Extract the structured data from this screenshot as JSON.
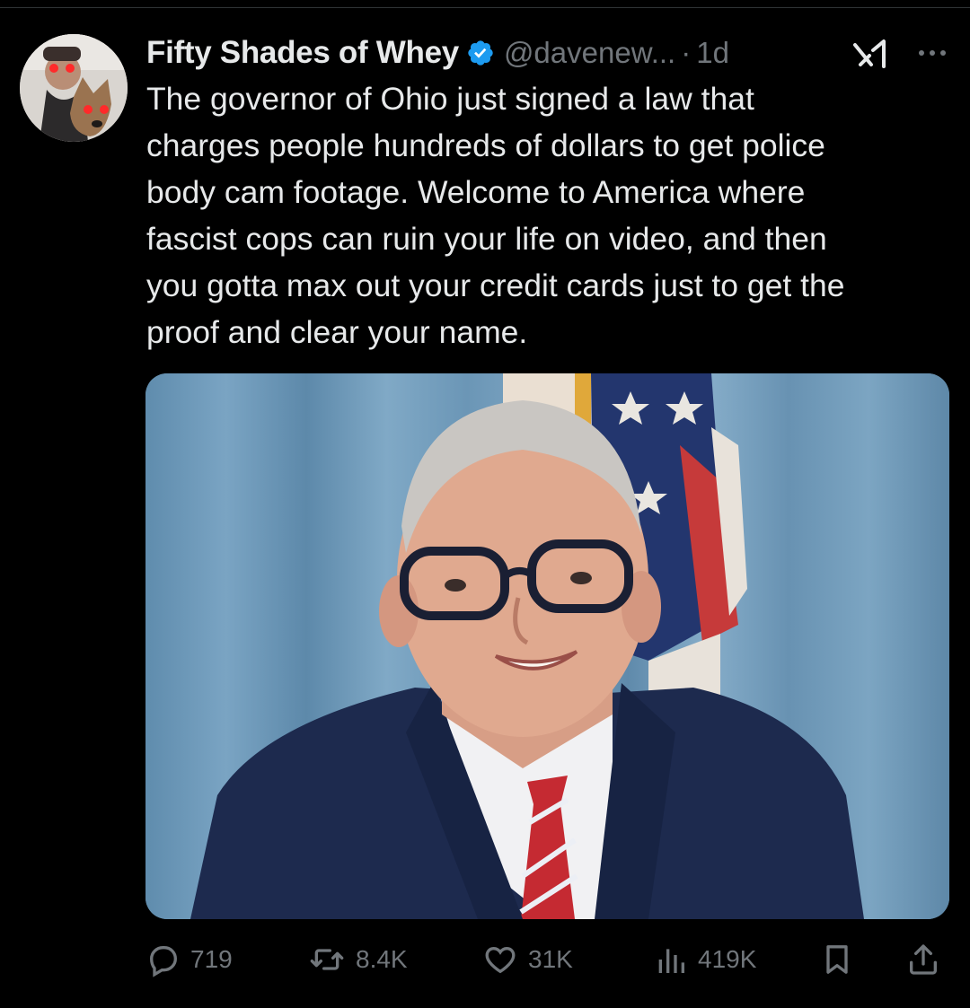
{
  "tweet": {
    "display_name": "Fifty Shades of Whey",
    "handle": "@davenew...",
    "separator": "·",
    "time": "1d",
    "text": "The governor of Ohio just signed a law that\ncharges people hundreds of dollars to get police\nbody cam footage. Welcome to America where\nfascist cops can ruin your life on video, and then\nyou gotta max out your credit cards just to get the\nproof and clear your name."
  },
  "icons": {
    "verified": "verified-badge-icon",
    "grok": "grok-icon",
    "more": "more-icon",
    "reply": "reply-icon",
    "repost": "repost-icon",
    "like": "like-icon",
    "views": "views-icon",
    "bookmark": "bookmark-icon",
    "share": "share-icon"
  },
  "actions": {
    "replies": "719",
    "reposts": "8.4K",
    "likes": "31K",
    "views": "419K"
  },
  "colors": {
    "background": "#000000",
    "text": "#e7e9ea",
    "muted": "#71767b",
    "verified": "#1d9bf0"
  }
}
